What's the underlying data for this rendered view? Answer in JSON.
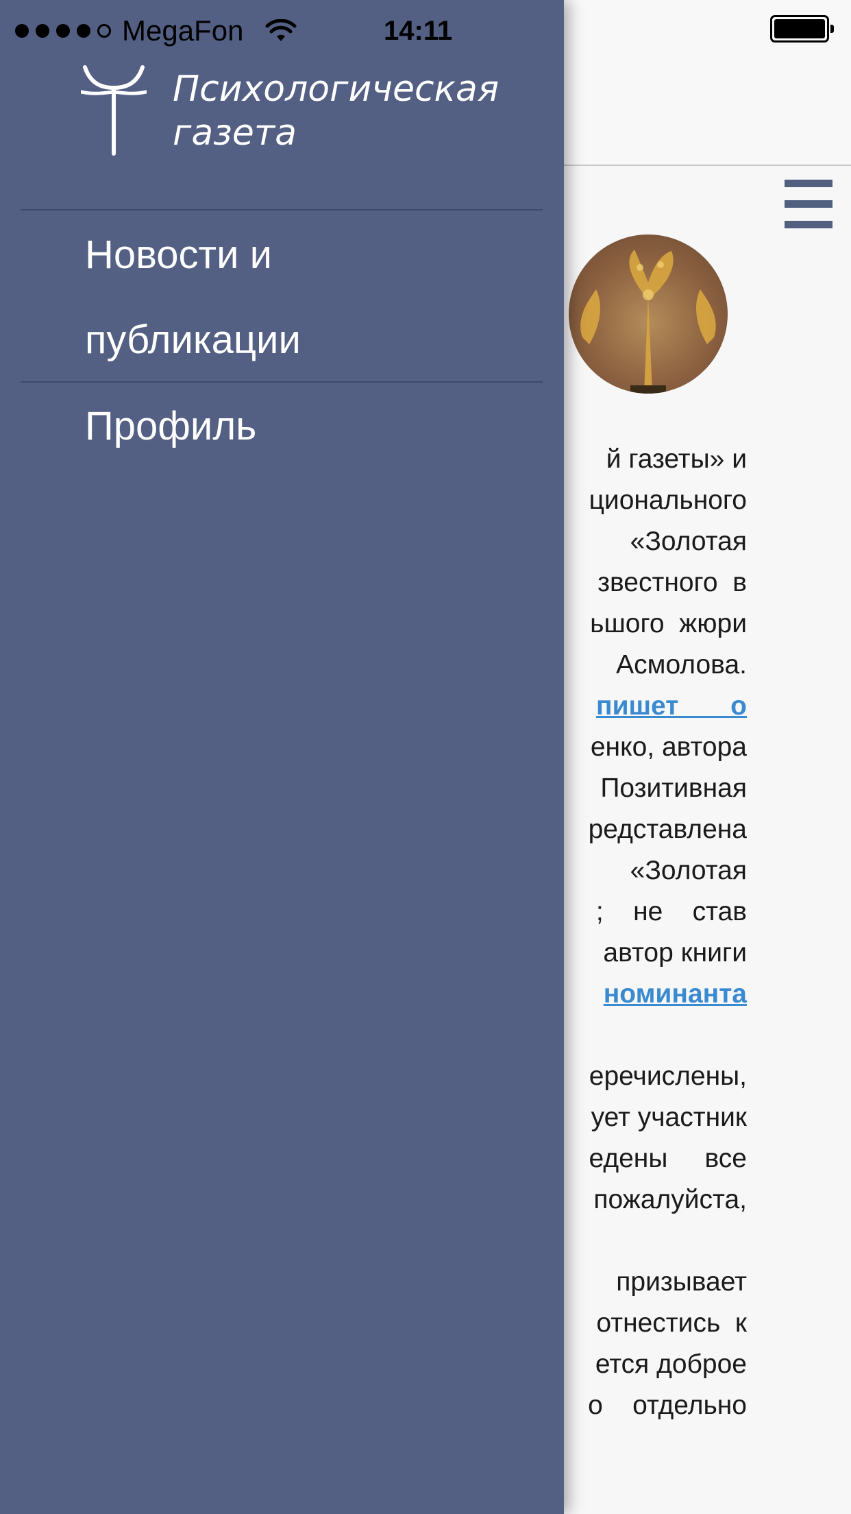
{
  "status_bar": {
    "carrier": "MegaFon",
    "time": "14:11",
    "signal_dots_filled": 4,
    "signal_dots_total": 5
  },
  "drawer": {
    "logo_line1": "Психологическая",
    "logo_line2": "газета",
    "menu": [
      {
        "label_line1": "Новости и",
        "label_line2": "публикации"
      },
      {
        "label_line1": "Профиль"
      }
    ],
    "background_color": "#535f83"
  },
  "article": {
    "lines": [
      "й газеты» и",
      "ционального",
      "«Золотая",
      "звестного  в",
      "ьшого  жюри",
      "Асмолова.",
      "пишет       о",
      "енко, автора",
      "Позитивная",
      "редставлена",
      "«Золотая",
      ";    не    став",
      "автор книги",
      "номинанта",
      "",
      "еречислены,",
      "ует участник",
      "едены     все",
      "пожалуйста,",
      "",
      "призывает",
      "отнестись  к",
      "ется доброе",
      "о    отдельно"
    ],
    "links": [
      "пишет       о",
      "номинанта"
    ],
    "link_color": "#3a8ad0"
  },
  "icons": {
    "menu": "hamburger-icon",
    "wifi": "wifi-icon",
    "battery": "battery-icon",
    "logo": "logo-mark"
  }
}
